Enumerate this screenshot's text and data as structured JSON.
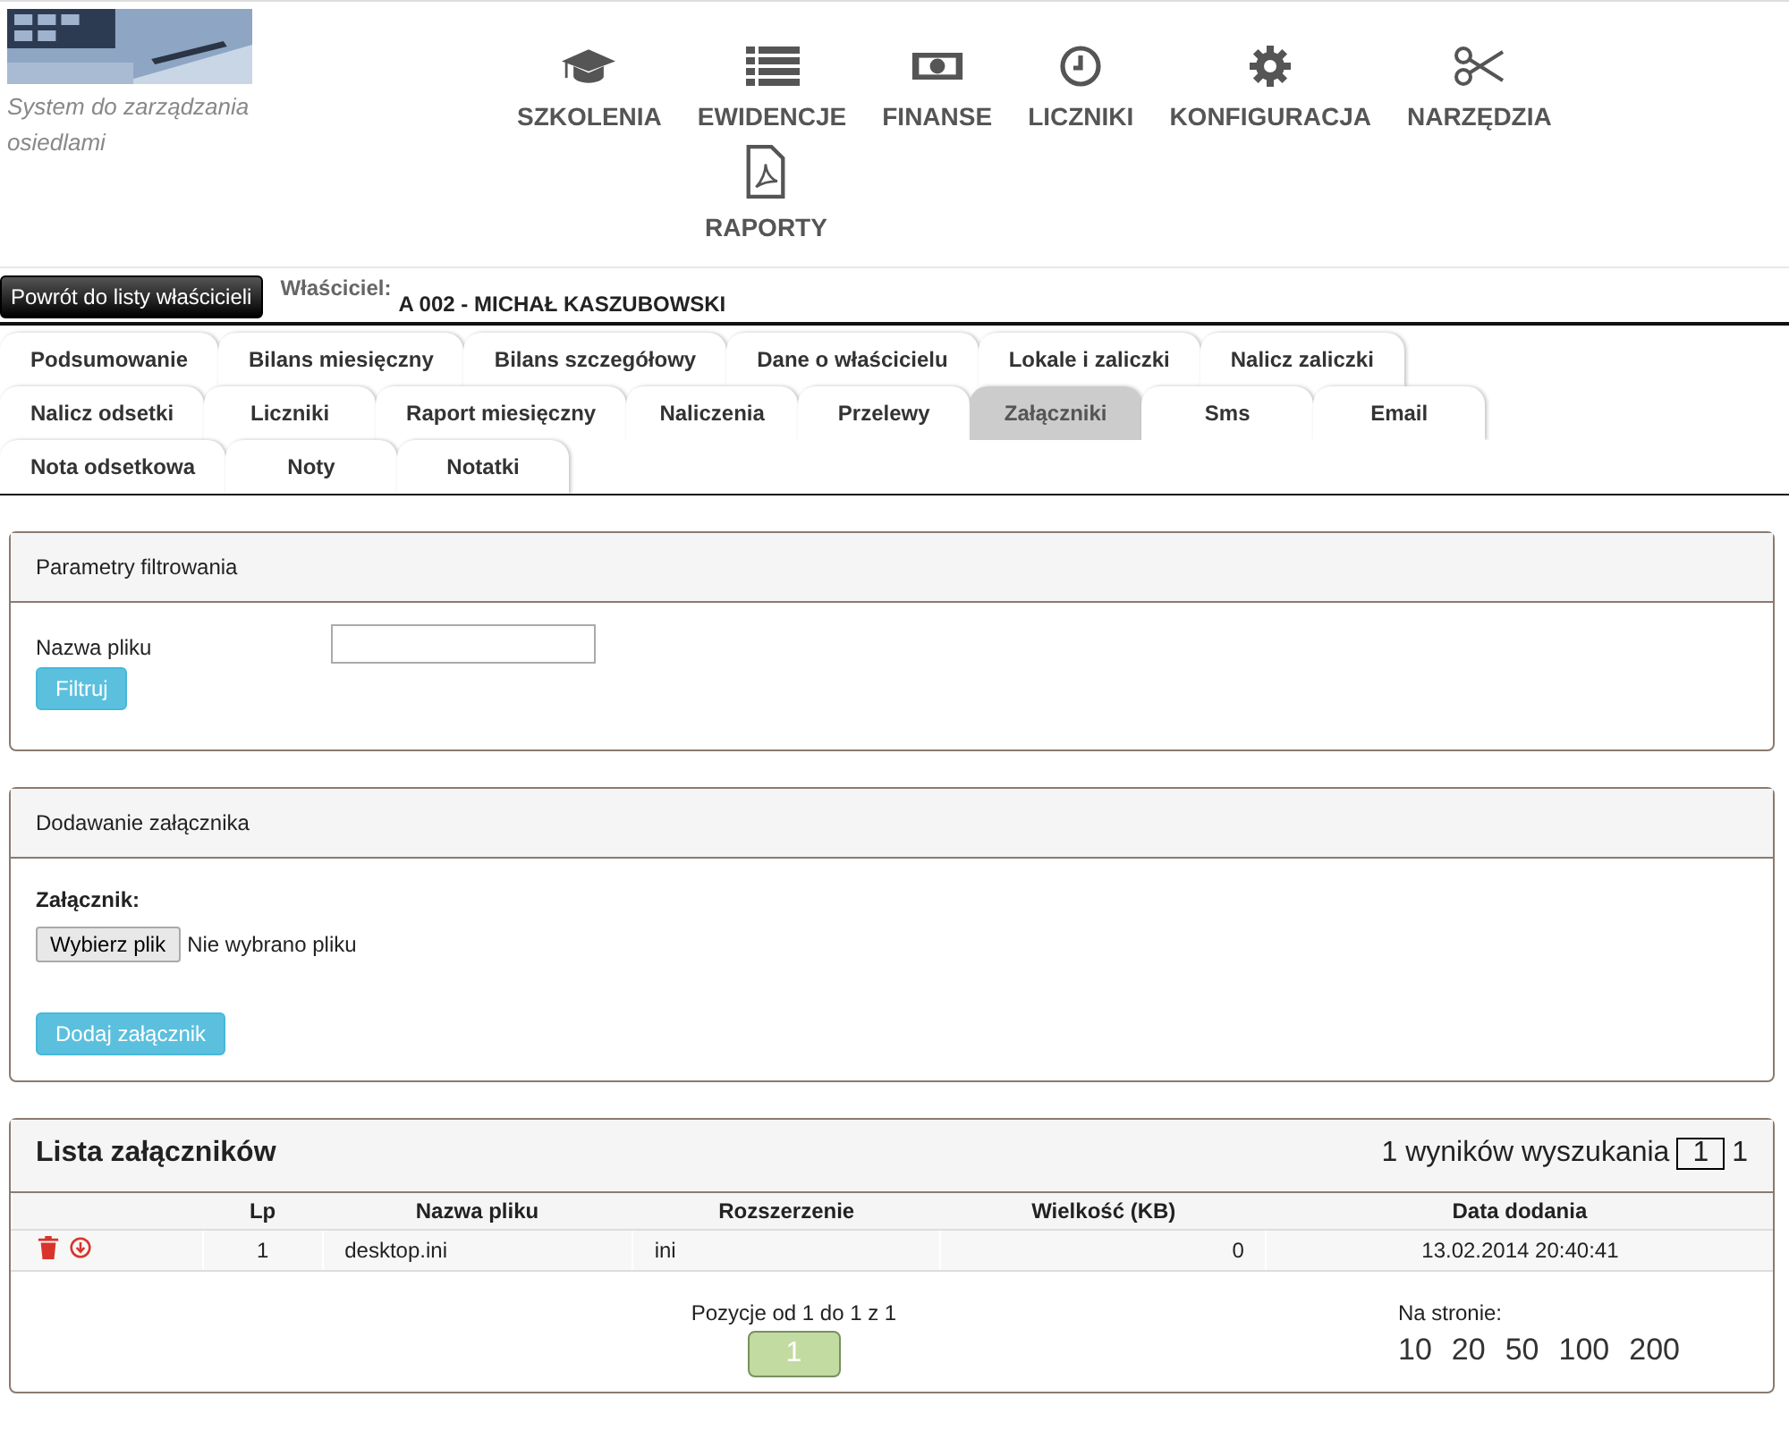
{
  "logo": {
    "kind": "picture",
    "caption": "System do zarządzania osiedlami"
  },
  "nav": [
    {
      "label": "SZKOLENIA",
      "kind": "cap"
    },
    {
      "label": "EWIDENCJE",
      "kind": "list"
    },
    {
      "label": "FINANSE",
      "kind": "money"
    },
    {
      "label": "LICZNIKI",
      "kind": "clock"
    },
    {
      "label": "KONFIGURACJA",
      "kind": "gear"
    },
    {
      "label": "NARZĘDZIA",
      "kind": "scissors"
    },
    {
      "label": "RAPORTY",
      "kind": "pdf"
    }
  ],
  "back_button": "Powrót do listy właścicieli",
  "owner": {
    "label": "Właściciel:",
    "value": "A 002 - MICHAŁ KASZUBOWSKI"
  },
  "tab_rows": [
    [
      {
        "label": "Podsumowanie",
        "selected": false
      },
      {
        "label": "Bilans miesięczny",
        "selected": false
      },
      {
        "label": "Bilans szczegółowy",
        "selected": false
      },
      {
        "label": "Dane o właścicielu",
        "selected": false
      },
      {
        "label": "Lokale i zaliczki",
        "selected": false
      },
      {
        "label": "Nalicz zaliczki",
        "selected": false
      }
    ],
    [
      {
        "label": "Nalicz odsetki",
        "selected": false
      },
      {
        "label": "Liczniki",
        "selected": false
      },
      {
        "label": "Raport miesięczny",
        "selected": false
      },
      {
        "label": "Naliczenia",
        "selected": false
      },
      {
        "label": "Przelewy",
        "selected": false
      },
      {
        "label": "Załączniki",
        "selected": true
      },
      {
        "label": "Sms",
        "selected": false
      },
      {
        "label": "Email",
        "selected": false
      }
    ],
    [
      {
        "label": "Nota odsetkowa",
        "selected": false
      },
      {
        "label": "Noty",
        "selected": false
      },
      {
        "label": "Notatki",
        "selected": false
      }
    ]
  ],
  "filter_panel": {
    "title": "Parametry filtrowania",
    "field_label": "Nazwa pliku",
    "button": "Filtruj"
  },
  "upload_panel": {
    "title": "Dodawanie załącznika",
    "field_label": "Załącznik:",
    "choose_button": "Wybierz plik",
    "no_file": "Nie wybrano pliku",
    "button": "Dodaj załącznik"
  },
  "list_panel": {
    "title": "Lista załączników",
    "results": "1 wyników wyszukania",
    "page_value": "1",
    "page_count": "1",
    "columns": [
      "Lp",
      "Nazwa pliku",
      "Rozszerzenie",
      "Wielkość (KB)",
      "Data dodania"
    ],
    "rows": [
      {
        "lp": "1",
        "name": "desktop.ini",
        "ext": "ini",
        "size": "0",
        "date": "13.02.2014 20:40:41"
      }
    ],
    "positions": "Pozycje od 1 do 1 z 1",
    "pages": [
      {
        "label": "1",
        "selected": true
      }
    ],
    "per_page_label": "Na stronie:",
    "per_page": [
      "10",
      "20",
      "50",
      "100",
      "200"
    ]
  }
}
